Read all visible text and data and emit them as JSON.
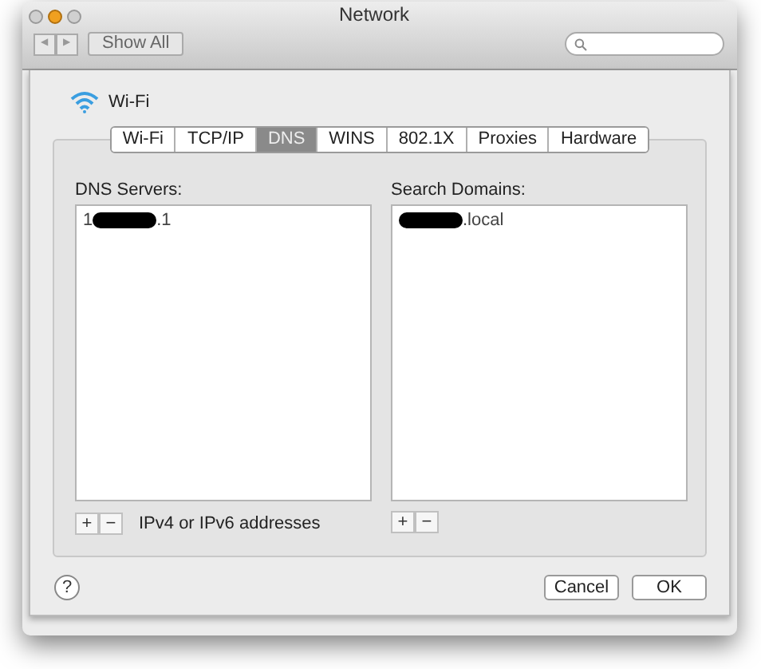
{
  "window": {
    "title": "Network"
  },
  "toolbar": {
    "nav_buttons": [
      "◀",
      "▶"
    ],
    "show_all": "Show All"
  },
  "service": {
    "name": "Wi-Fi"
  },
  "tabs": [
    {
      "label": "Wi-Fi",
      "selected": false
    },
    {
      "label": "TCP/IP",
      "selected": false
    },
    {
      "label": "DNS",
      "selected": true
    },
    {
      "label": "WINS",
      "selected": false
    },
    {
      "label": "802.1X",
      "selected": false
    },
    {
      "label": "Proxies",
      "selected": false
    },
    {
      "label": "Hardware",
      "selected": false
    }
  ],
  "dns_servers": {
    "label": "DNS Servers:",
    "entries": [
      {
        "before": "1",
        "after": ".1"
      }
    ],
    "buttons": [
      "+",
      "−"
    ],
    "hint": "IPv4 or IPv6 addresses"
  },
  "search_domains": {
    "label": "Search Domains:",
    "entries": [
      {
        "after": ".local"
      }
    ],
    "buttons": [
      "+",
      "−"
    ]
  },
  "help": "?",
  "buttons": [
    {
      "label": "Cancel",
      "default": false
    },
    {
      "label": "OK",
      "default": false
    }
  ]
}
